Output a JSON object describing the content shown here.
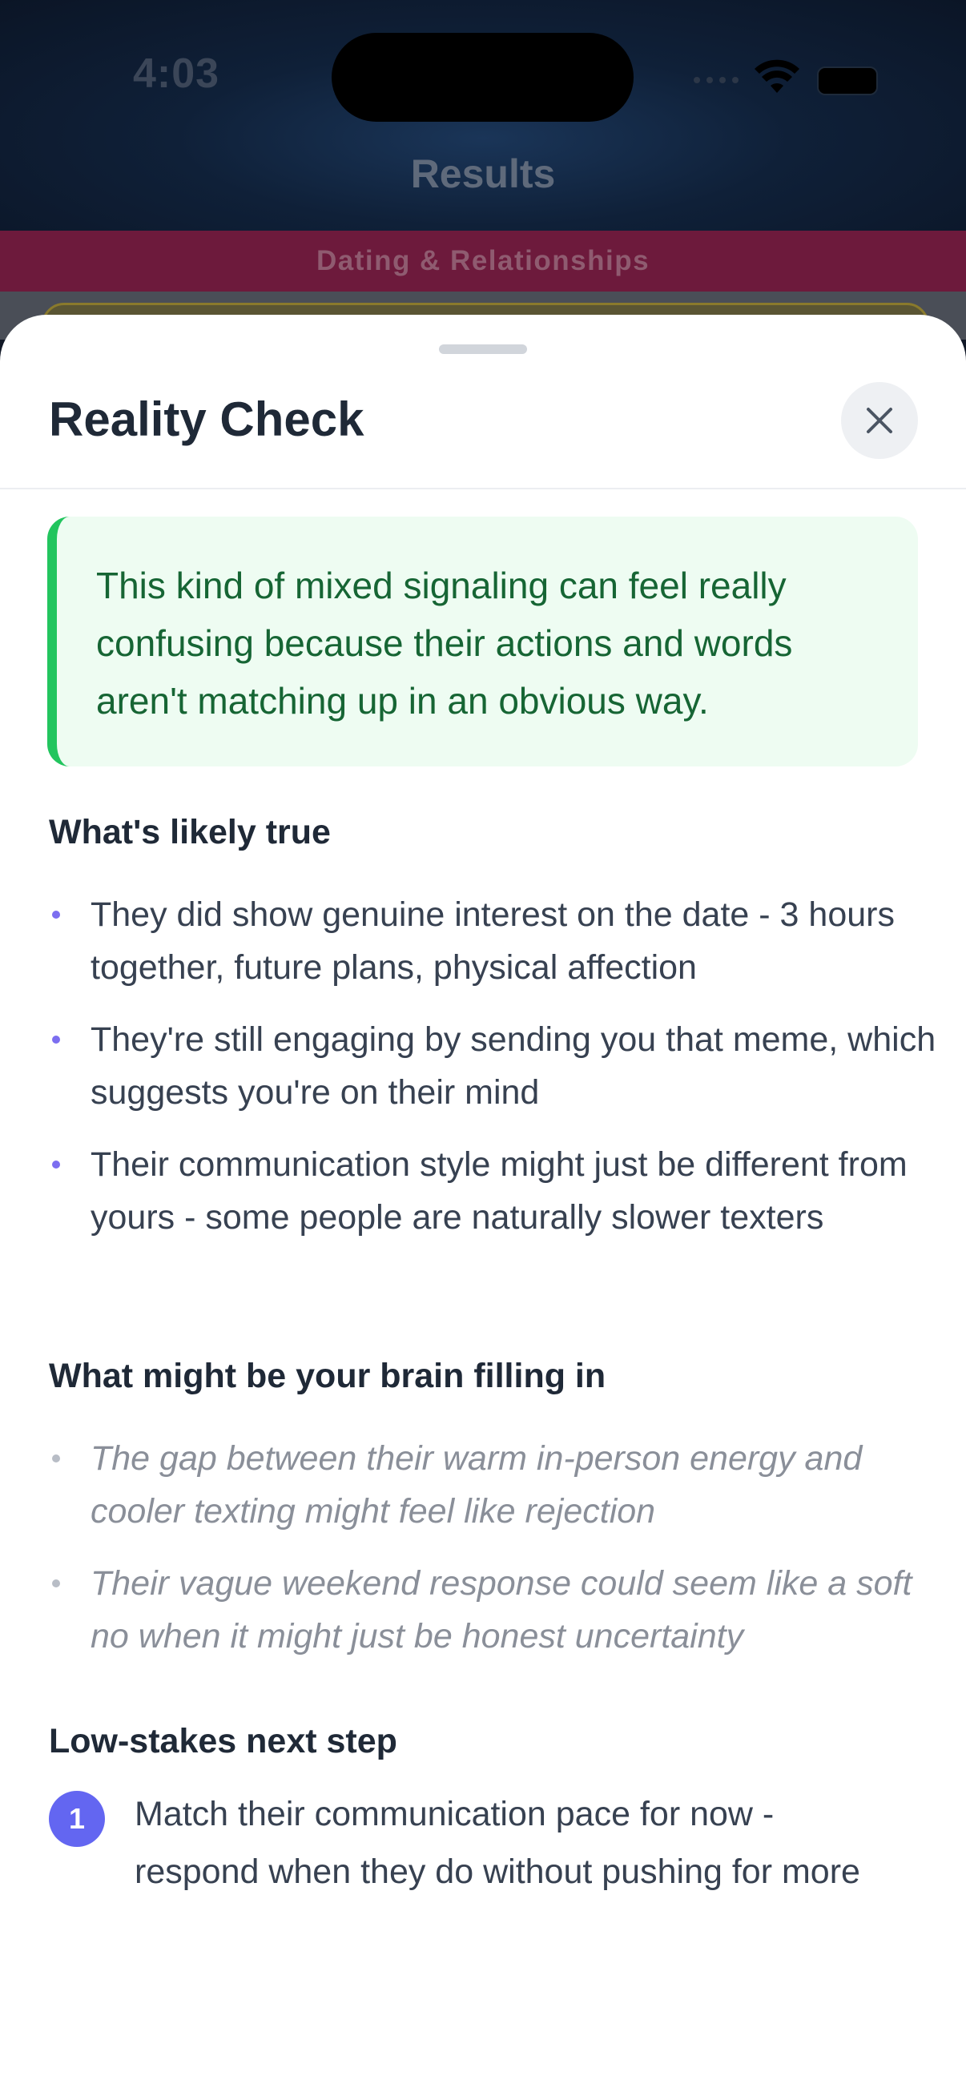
{
  "status_bar": {
    "time": "4:03"
  },
  "background": {
    "title": "Results",
    "category": "Dating & Relationships"
  },
  "sheet": {
    "title": "Reality Check",
    "close_icon": "close-icon",
    "callout": "This kind of mixed signaling can feel really confusing because their actions and words aren't matching up in an obvious way.",
    "likely_true": {
      "heading": "What's likely true",
      "items": [
        "They did show genuine interest on the date - 3 hours together, future plans, physical affection",
        "They're still engaging by sending you that meme, which suggests you're on their mind",
        "Their communication style might just be different from yours - some people are naturally slower texters"
      ]
    },
    "brain_filling": {
      "heading": "What might be your brain filling in",
      "items": [
        "The gap between their warm in-person energy and cooler texting might feel like rejection",
        "Their vague weekend response could seem like a soft no when it might just be honest uncertainty"
      ]
    },
    "next_step": {
      "heading": "Low-stakes next step",
      "number": "1",
      "text": "Match their communication pace for now - respond when they do without pushing for more"
    }
  },
  "colors": {
    "accent_green": "#22c55e",
    "callout_text": "#166534",
    "bullet_blue": "#7c6ef0",
    "step_badge": "#6366f1",
    "category_bar": "#6d1a3c"
  }
}
